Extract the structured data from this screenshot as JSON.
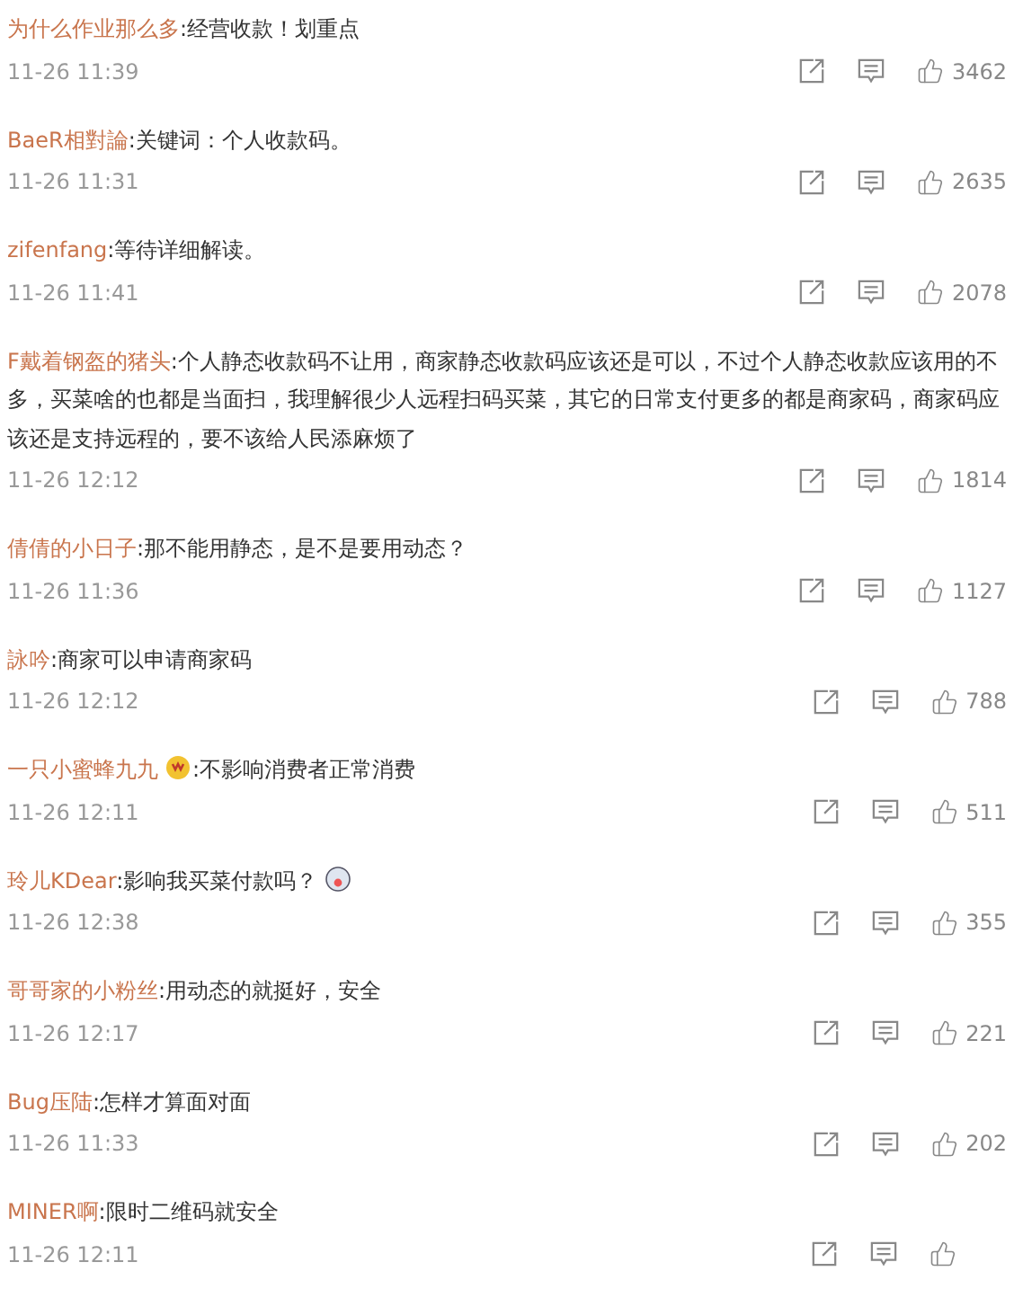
{
  "comments": [
    {
      "user": "为什么作业那么多",
      "text": ":经营收款！划重点",
      "time": "11-26 11:39",
      "likes": "3462"
    },
    {
      "user": "BaeR相對論",
      "text": ":关键词：个人收款码。",
      "time": "11-26 11:31",
      "likes": "2635"
    },
    {
      "user": "zifenfang",
      "text": ":等待详细解读。",
      "time": "11-26 11:41",
      "likes": "2078"
    },
    {
      "user": "F戴着钢盔的猪头",
      "text": ":个人静态收款码不让用，商家静态收款码应该还是可以，不过个人静态收款应该用的不多，买菜啥的也都是当面扫，我理解很少人远程扫码买菜，其它的日常支付更多的都是商家码，商家码应该还是支持远程的，要不该给人民添麻烦了",
      "time": "11-26 12:12",
      "likes": "1814"
    },
    {
      "user": "倩倩的小日子",
      "text": ":那不能用静态，是不是要用动态？",
      "time": "11-26 11:36",
      "likes": "1127"
    },
    {
      "user": "詠吟",
      "text": ":商家可以申请商家码",
      "time": "11-26 12:12",
      "likes": "788"
    },
    {
      "user": "一只小蜜蜂九九",
      "user_badge": true,
      "text": ":不影响消费者正常消费",
      "time": "11-26 12:11",
      "likes": "511"
    },
    {
      "user": "玲儿KDear",
      "text": ":影响我买菜付款吗？",
      "emoji": true,
      "time": "11-26 12:38",
      "likes": "355"
    },
    {
      "user": "哥哥家的小粉丝",
      "text": ":用动态的就挺好，安全",
      "time": "11-26 12:17",
      "likes": "221"
    },
    {
      "user": "Bug压陆",
      "text": ":怎样才算面对面",
      "time": "11-26 11:33",
      "likes": "202"
    },
    {
      "user": "MINER啊",
      "text": ":限时二维码就安全",
      "time": "11-26 12:11"
    }
  ]
}
